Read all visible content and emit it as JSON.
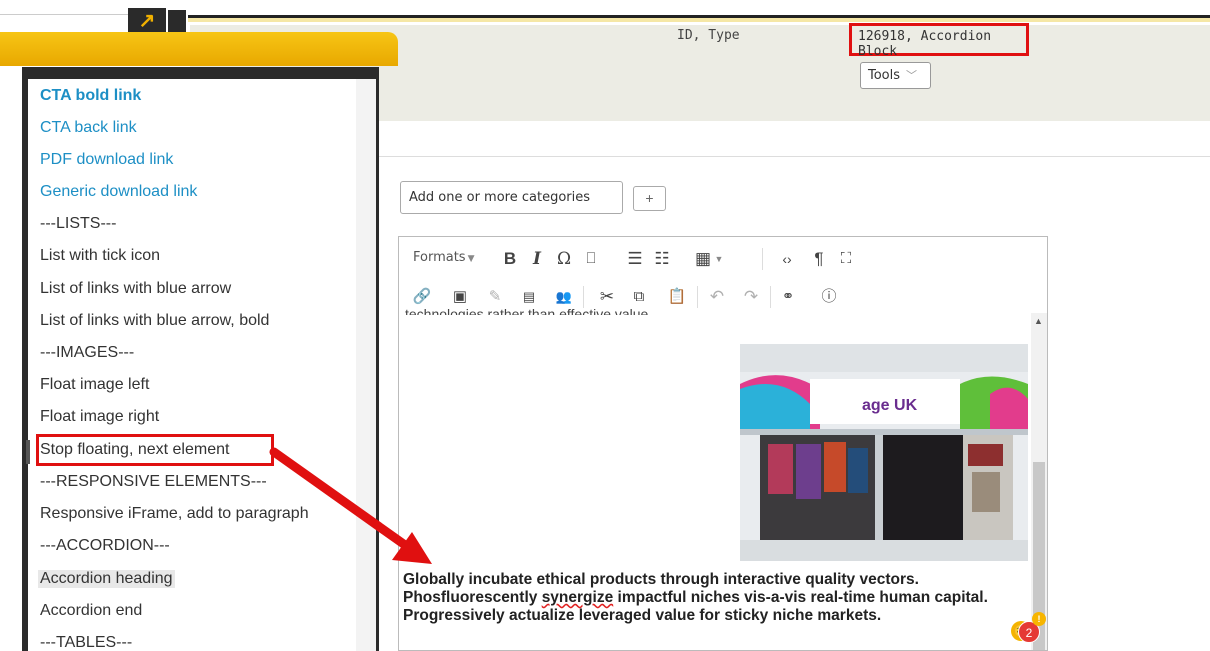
{
  "header": {
    "id_type_label": "ID, Type",
    "id_type_value": "126918, Accordion Block",
    "tools_label": "Tools"
  },
  "categories": {
    "input_label": "Add one or more categories",
    "add_label": "+"
  },
  "editor": {
    "formats_label": "Formats",
    "paragraph_parts": {
      "before": "Globally incubate ethical products through interactive quality vectors. Phosfluorescently ",
      "misspelled": "synergize",
      "after": " impactful niches vis-a-vis real-time human capital. Progressively actualize leveraged value for sticky niche markets."
    },
    "image_brand": "age UK",
    "notification_count": "2",
    "notification_dot": "!"
  },
  "styles_menu": {
    "items": [
      {
        "label": "CTA bold link"
      },
      {
        "label": "CTA back link"
      },
      {
        "label": "PDF download link"
      },
      {
        "label": "Generic download link"
      },
      {
        "label": "---LISTS---"
      },
      {
        "label": "List with tick icon"
      },
      {
        "label": "List of links with blue arrow"
      },
      {
        "label": "List of links with blue arrow, bold"
      },
      {
        "label": "---IMAGES---"
      },
      {
        "label": "Float image left"
      },
      {
        "label": "Float image right"
      },
      {
        "label": "Stop floating, next element"
      },
      {
        "label": "---RESPONSIVE ELEMENTS---"
      },
      {
        "label": "Responsive iFrame, add to paragraph"
      },
      {
        "label": "---ACCORDION---"
      },
      {
        "label": "Accordion heading"
      },
      {
        "label": "Accordion end"
      },
      {
        "label": "---TABLES---"
      }
    ]
  },
  "colors": {
    "highlight_red": "#e01010",
    "link_blue": "#1d8fc5",
    "menu_gold": "#f7c515"
  }
}
